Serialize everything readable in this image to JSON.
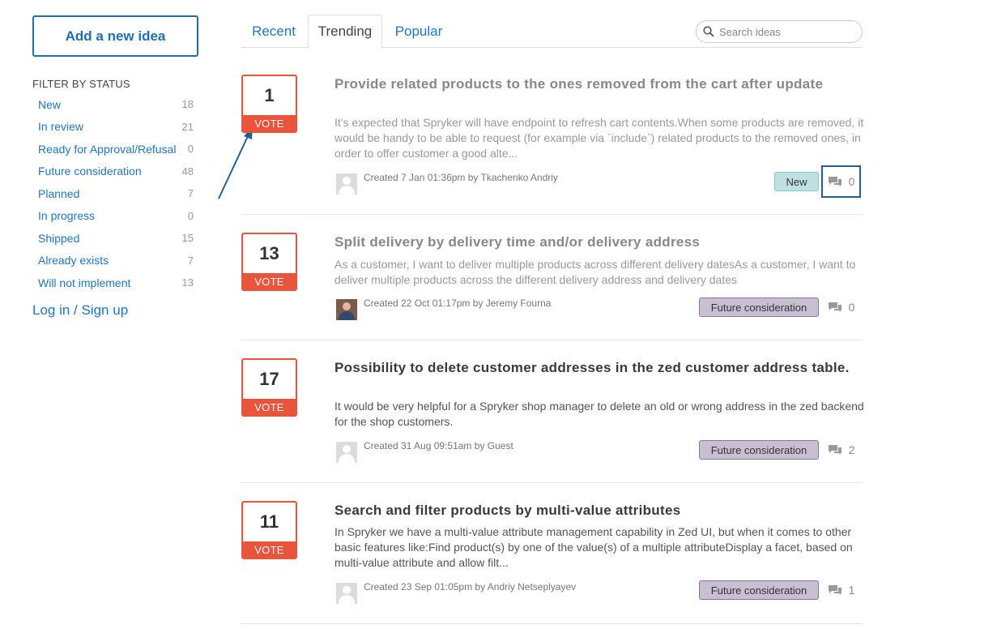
{
  "sidebar": {
    "add_idea_label": "Add a new idea",
    "filter_title": "FILTER BY STATUS",
    "statuses": [
      {
        "label": "New",
        "count": "18"
      },
      {
        "label": "In review",
        "count": "21"
      },
      {
        "label": "Ready for Approval/Refusal",
        "count": "0"
      },
      {
        "label": "Future consideration",
        "count": "48"
      },
      {
        "label": "Planned",
        "count": "7"
      },
      {
        "label": "In progress",
        "count": "0"
      },
      {
        "label": "Shipped",
        "count": "15"
      },
      {
        "label": "Already exists",
        "count": "7"
      },
      {
        "label": "Will not implement",
        "count": "13"
      }
    ],
    "login_label": "Log in / Sign up"
  },
  "tabs": [
    {
      "label": "Recent"
    },
    {
      "label": "Trending"
    },
    {
      "label": "Popular"
    }
  ],
  "search": {
    "placeholder": "Search ideas"
  },
  "ideas": [
    {
      "votes": "1",
      "vote_label": "VOTE",
      "title": "Provide related products to the ones removed from the cart after update",
      "description": "It's expected that Spryker will have endpoint to refresh cart contents.When some products are removed, it would be handy to be able to request (for example via `include`) related products to the removed ones, in order to offer customer a good alte...",
      "meta": "Created 7 Jan 01:36pm by Tkachenko Andriy",
      "status": "New",
      "comments": "0"
    },
    {
      "votes": "13",
      "vote_label": "VOTE",
      "title": "Split delivery by delivery time and/or delivery address",
      "description": "As a customer, I want to deliver multiple products across different delivery datesAs a customer, I want to deliver multiple products across the different delivery address and delivery dates",
      "meta": "Created 22 Oct 01:17pm by Jeremy Fourna",
      "status": "Future consideration",
      "comments": "0"
    },
    {
      "votes": "17",
      "vote_label": "VOTE",
      "title": "Possibility to delete customer addresses in the zed customer address table.",
      "description": "It would be very helpful for a Spryker shop manager to delete an old or wrong address in the zed backend for the shop customers.",
      "meta": "Created 31 Aug 09:51am by Guest",
      "status": "Future consideration",
      "comments": "2"
    },
    {
      "votes": "11",
      "vote_label": "VOTE",
      "title": "Search and filter products by multi-value attributes",
      "description": "In Spryker we have a multi-value attribute management capability in Zed UI, but when it comes to other basic features like:Find product(s) by one of the value(s) of a multiple attributeDisplay a facet, based on multi-value attribute and allow filt...",
      "meta": "Created 23 Sep 01:05pm by Andriy Netseplyayev",
      "status": "Future consideration",
      "comments": "1"
    }
  ],
  "colors": {
    "accent_blue": "#1f76c2",
    "vote_red": "#e8553c",
    "badge_new": "#bfe0e0",
    "badge_future": "#c9bfd3"
  }
}
